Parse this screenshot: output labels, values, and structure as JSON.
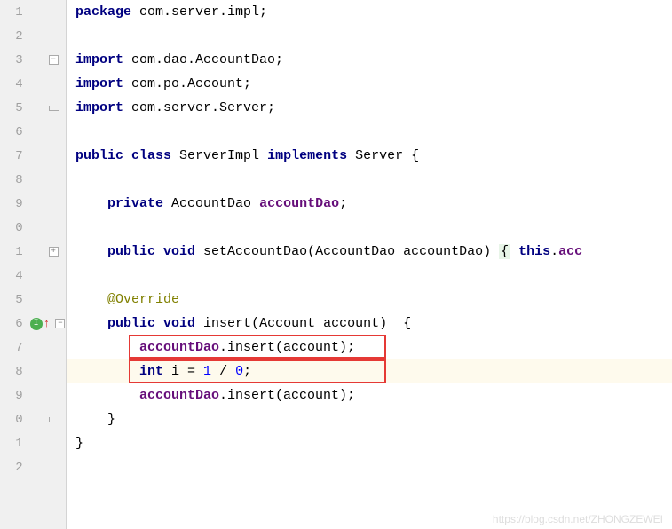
{
  "lines": [
    {
      "num": "1",
      "tokens": [
        [
          "kw",
          "package "
        ],
        [
          "plain",
          "com.server.impl"
        ],
        [
          "plain",
          ";"
        ]
      ],
      "indent": 0,
      "fold": null
    },
    {
      "num": "2",
      "tokens": [],
      "indent": 0,
      "fold": null
    },
    {
      "num": "3",
      "tokens": [
        [
          "kw",
          "import "
        ],
        [
          "plain",
          "com.dao.AccountDao"
        ],
        [
          "plain",
          ";"
        ]
      ],
      "indent": 0,
      "fold": "minus"
    },
    {
      "num": "4",
      "tokens": [
        [
          "kw",
          "import "
        ],
        [
          "plain",
          "com.po.Account"
        ],
        [
          "plain",
          ";"
        ]
      ],
      "indent": 0,
      "fold": null
    },
    {
      "num": "5",
      "tokens": [
        [
          "kw",
          "import "
        ],
        [
          "plain",
          "com.server.Server"
        ],
        [
          "plain",
          ";"
        ]
      ],
      "indent": 0,
      "fold": "end"
    },
    {
      "num": "6",
      "tokens": [],
      "indent": 0,
      "fold": null
    },
    {
      "num": "7",
      "tokens": [
        [
          "kw",
          "public class "
        ],
        [
          "plain",
          "ServerImpl "
        ],
        [
          "kw",
          "implements "
        ],
        [
          "plain",
          "Server {"
        ]
      ],
      "indent": 0,
      "fold": null
    },
    {
      "num": "8",
      "tokens": [],
      "indent": 0,
      "fold": null
    },
    {
      "num": "9",
      "tokens": [
        [
          "kw",
          "private "
        ],
        [
          "plain",
          "AccountDao "
        ],
        [
          "field",
          "accountDao"
        ],
        [
          "plain",
          ";"
        ]
      ],
      "indent": 1,
      "fold": null
    },
    {
      "num": "0",
      "tokens": [],
      "indent": 0,
      "fold": null
    },
    {
      "num": "1",
      "tokens": [
        [
          "kw",
          "public void "
        ],
        [
          "method",
          "setAccountDao"
        ],
        [
          "plain",
          "(AccountDao accountDao) "
        ],
        [
          "hint",
          "{"
        ],
        [
          "kw",
          " this"
        ],
        [
          "plain",
          "."
        ],
        [
          "field",
          "acc"
        ]
      ],
      "indent": 1,
      "fold": "plus"
    },
    {
      "num": "4",
      "tokens": [],
      "indent": 0,
      "fold": null
    },
    {
      "num": "5",
      "tokens": [
        [
          "annotation",
          "@Override"
        ]
      ],
      "indent": 1,
      "fold": null
    },
    {
      "num": "6",
      "tokens": [
        [
          "kw",
          "public void "
        ],
        [
          "method",
          "insert"
        ],
        [
          "plain",
          "(Account account)  {"
        ]
      ],
      "indent": 1,
      "fold": "minus",
      "status": true
    },
    {
      "num": "7",
      "tokens": [
        [
          "field",
          "accountDao"
        ],
        [
          "plain",
          ".insert(account);"
        ]
      ],
      "indent": 2,
      "fold": null,
      "redbox": true
    },
    {
      "num": "8",
      "tokens": [
        [
          "kw",
          "int "
        ],
        [
          "plain",
          "i = "
        ],
        [
          "num",
          "1"
        ],
        [
          "plain",
          " / "
        ],
        [
          "num",
          "0"
        ],
        [
          "plain",
          ";"
        ]
      ],
      "indent": 2,
      "fold": null,
      "redbox": true,
      "highlight": true
    },
    {
      "num": "9",
      "tokens": [
        [
          "field",
          "accountDao"
        ],
        [
          "plain",
          ".insert(account);"
        ]
      ],
      "indent": 2,
      "fold": null
    },
    {
      "num": "0",
      "tokens": [
        [
          "plain",
          "}"
        ]
      ],
      "indent": 1,
      "fold": "end"
    },
    {
      "num": "1",
      "tokens": [
        [
          "plain",
          "}"
        ]
      ],
      "indent": 0,
      "fold": null
    },
    {
      "num": "2",
      "tokens": [],
      "indent": 0,
      "fold": null
    }
  ],
  "watermark": "https://blog.csdn.net/ZHONGZEWEI"
}
